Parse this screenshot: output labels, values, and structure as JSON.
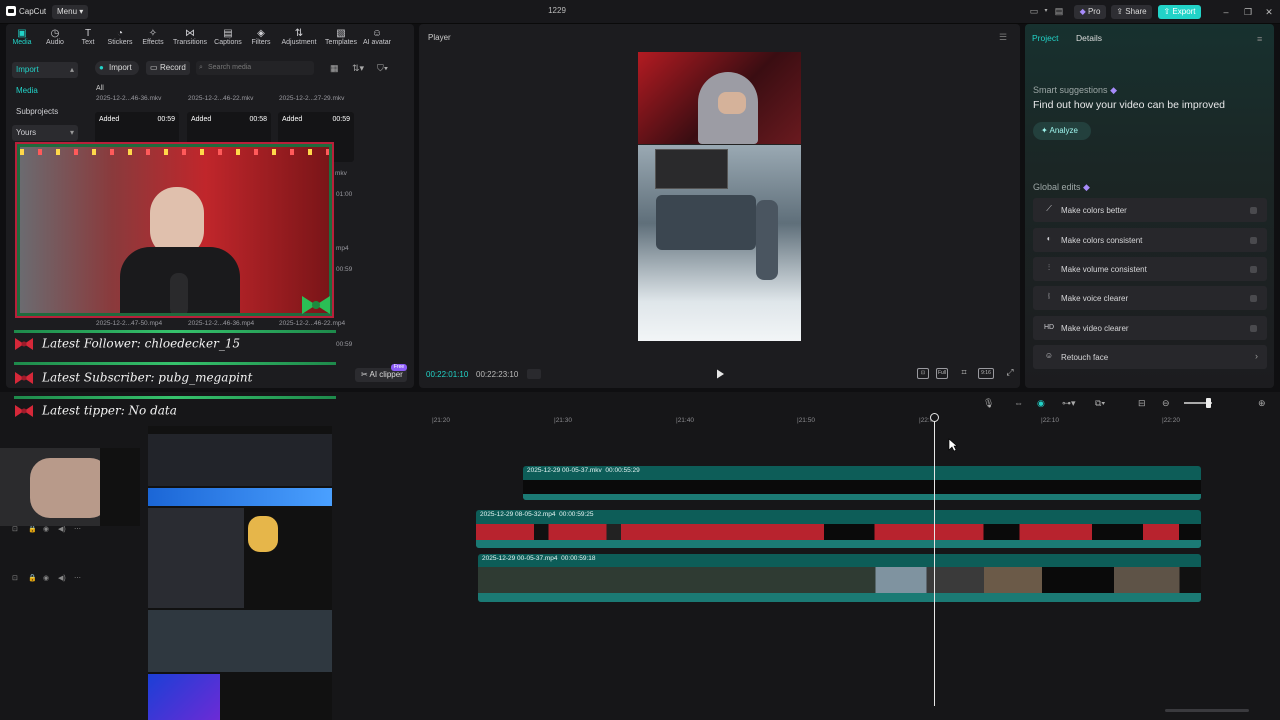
{
  "app": {
    "name": "CapCut",
    "menu_label": "Menu",
    "project_title": "1229"
  },
  "topbar": {
    "pro_label": "Pro",
    "share_label": "Share",
    "export_label": "Export"
  },
  "tools": [
    {
      "label": "Media",
      "glyph": "▣"
    },
    {
      "label": "Audio",
      "glyph": "◷"
    },
    {
      "label": "Text",
      "glyph": "T"
    },
    {
      "label": "Stickers",
      "glyph": "◔"
    },
    {
      "label": "Effects",
      "glyph": "✧"
    },
    {
      "label": "Transitions",
      "glyph": "⋈"
    },
    {
      "label": "Captions",
      "glyph": "▤"
    },
    {
      "label": "Filters",
      "glyph": "◈"
    },
    {
      "label": "Adjustment",
      "glyph": "⇅"
    },
    {
      "label": "Templates",
      "glyph": "▧"
    },
    {
      "label": "AI avatar",
      "glyph": "☺"
    }
  ],
  "sidebar": {
    "items": [
      "Import",
      "Media",
      "Subprojects",
      "Yours"
    ]
  },
  "media": {
    "import_label": "Import",
    "record_label": "Record",
    "search_placeholder": "Search media",
    "filter_all": "All",
    "files_row1": [
      "2025-12-2...46-36.mkv",
      "2025-12-2...46-22.mkv",
      "2025-12-2...27-29.mkv"
    ],
    "thumbs_row1": [
      {
        "added": "Added",
        "dur": "00:59"
      },
      {
        "added": "Added",
        "dur": "00:58"
      },
      {
        "added": "Added",
        "dur": "00:59"
      }
    ],
    "files_row2": [
      "2025-12-2...47-50.mp4",
      "2025-12-2...46-36.mp4",
      "2025-12-2...46-22.mp4"
    ],
    "side_fragments": [
      "mkv",
      "01:00",
      "mp4",
      "00:59",
      "00:59"
    ],
    "ai_clipper_label": "AI clipper",
    "ai_clipper_badge": "Free"
  },
  "player": {
    "title": "Player",
    "time_current": "00:22:01:10",
    "time_total": "00:22:23:10",
    "ratio_label": "9:16",
    "full_label": "Full"
  },
  "right_panel": {
    "tab_project": "Project",
    "tab_details": "Details",
    "smart_title": "Smart suggestions",
    "smart_sub": "Find out how your video can be improved",
    "analyze_label": "Analyze",
    "global_title": "Global edits",
    "global_edits": [
      {
        "label": "Make colors better",
        "icon": "wand-icon",
        "glyph": "⟋"
      },
      {
        "label": "Make colors consistent",
        "icon": "palette-icon",
        "glyph": "◐"
      },
      {
        "label": "Make volume consistent",
        "icon": "equalizer-icon",
        "glyph": "⫶"
      },
      {
        "label": "Make voice clearer",
        "icon": "waveform-icon",
        "glyph": "⦚"
      },
      {
        "label": "Make video clearer",
        "icon": "hd-icon",
        "glyph": "HD"
      },
      {
        "label": "Retouch face",
        "icon": "face-icon",
        "glyph": "☺"
      }
    ]
  },
  "timeline": {
    "ruler_ticks": [
      "|21:20",
      "|21:30",
      "|21:40",
      "|21:50",
      "|22:00",
      "|22:10",
      "|22:20"
    ],
    "clips": [
      {
        "name": "2025-12-29 00-05-37.mkv",
        "dur": "00:00:55:29"
      },
      {
        "name": "2025-12-29 08-05-32.mp4",
        "dur": "00:00:59:25"
      },
      {
        "name": "2025-12-29 00-05-37.mp4",
        "dur": "00:00:59:18"
      }
    ]
  },
  "overlay": {
    "follower": "Latest Follower: chloedecker_15",
    "subscriber": "Latest Subscriber: pubg_megapint",
    "tipper": "Latest tipper: No data"
  },
  "colors": {
    "accent": "#22d3c8",
    "clip": "#0d5d58",
    "panel": "#1c1c1f",
    "red_glow": "#c0262b",
    "garland": "#1f6b3d"
  }
}
